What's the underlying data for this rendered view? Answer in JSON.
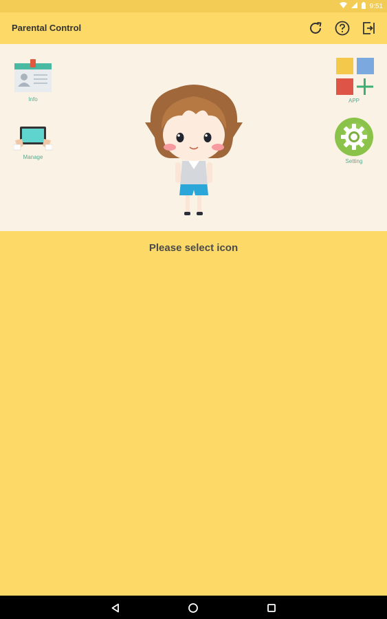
{
  "status_bar": {
    "time": "9:51"
  },
  "app_bar": {
    "title": "Parental Control",
    "actions": [
      {
        "icon": "refresh-icon"
      },
      {
        "icon": "help-icon"
      },
      {
        "icon": "exit-icon"
      }
    ]
  },
  "tiles": {
    "info": {
      "label": "Info",
      "icon": "id-card-icon"
    },
    "manage": {
      "label": "Manage",
      "icon": "tablet-icon"
    },
    "app": {
      "label": "APP",
      "icon": "apps-grid-icon"
    },
    "setting": {
      "label": "Setting",
      "icon": "gear-icon"
    }
  },
  "mascot": {
    "icon": "character-mascot"
  },
  "hint_text": "Please select icon",
  "colors": {
    "primary": "#FDDA67",
    "panel": "#FAF3E5",
    "label_green": "#5AA88E",
    "setting_green": "#8BC34A"
  },
  "nav_bar": {
    "buttons": [
      "back-icon",
      "home-icon",
      "recents-icon"
    ]
  }
}
